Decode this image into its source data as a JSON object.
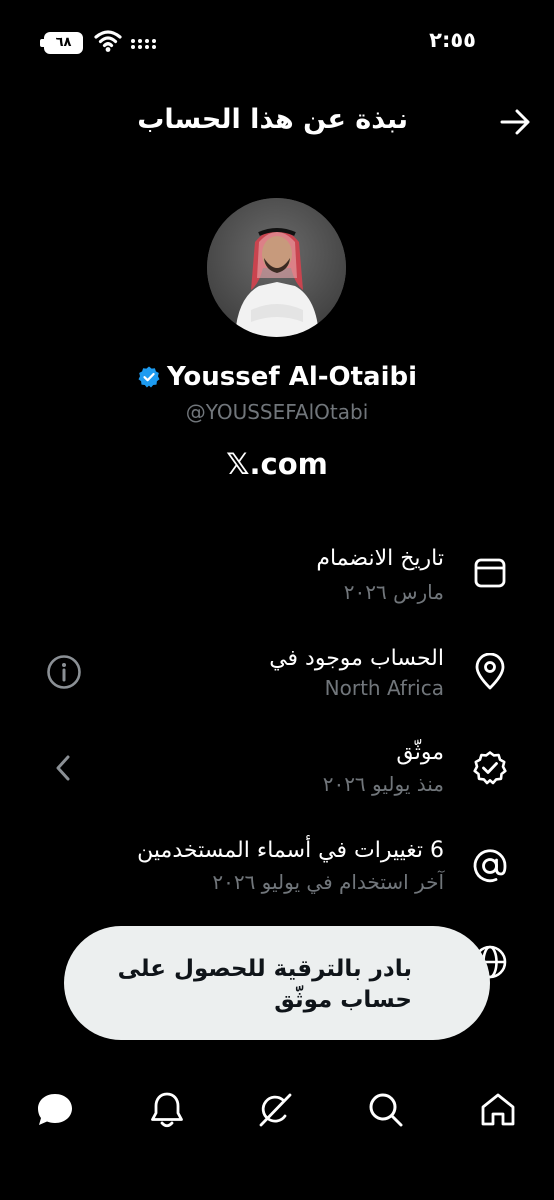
{
  "status_bar": {
    "time": "٢:٥٥",
    "battery_level": "٦٨",
    "icons": [
      "battery-icon",
      "wifi-icon",
      "cellular-signal-icon"
    ]
  },
  "header": {
    "title": "نبذة عن هذا الحساب",
    "back_icon": "arrow-right-icon"
  },
  "profile": {
    "display_name": "Youssef Al-Otaibi",
    "handle": "@YOUSSEFAlOtabi",
    "site": "𝕏.com",
    "verified": true
  },
  "info_rows": [
    {
      "icon": "calendar-icon",
      "title": "تاريخ الانضمام",
      "subtitle": "مارس ٢٠٢٦"
    },
    {
      "icon": "location-pin-icon",
      "title": "الحساب موجود في",
      "subtitle": "North Africa",
      "action_icon": "info-icon"
    },
    {
      "icon": "verified-badge-icon",
      "title": "موثّق",
      "subtitle": "منذ يوليو ٢٠٢٦",
      "action_icon": "chevron-left-icon"
    },
    {
      "icon": "at-sign-icon",
      "title": "6 تغييرات في أسماء المستخدمين",
      "subtitle": "آخر استخدام في يوليو ٢٠٢٦"
    }
  ],
  "toast": {
    "text": "بادر بالترقية للحصول على حساب موثّق"
  },
  "bottom_nav": {
    "items": [
      "messages-icon",
      "notifications-icon",
      "grok-icon",
      "search-icon",
      "home-icon"
    ]
  },
  "colors": {
    "background": "#000000",
    "text_primary": "#e7e9ea",
    "text_secondary": "#71767b",
    "verified_blue": "#1d9bf0",
    "toast_bg": "#ecefef"
  }
}
